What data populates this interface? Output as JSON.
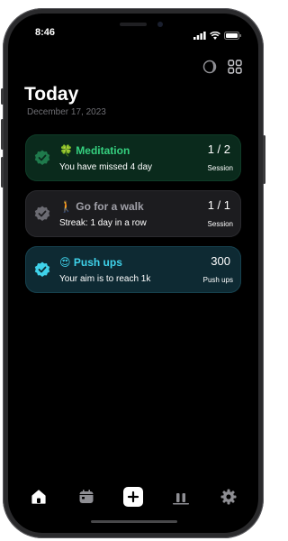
{
  "status_bar": {
    "time": "8:46"
  },
  "header": {
    "title": "Today",
    "date": "December 17, 2023"
  },
  "colors": {
    "meditation": "#35d07f",
    "walk": "#a0a0a8",
    "pushups": "#3fd2ea"
  },
  "habits": [
    {
      "emoji": "🍀",
      "name": "Meditation",
      "subtitle": "You have missed 4 day",
      "count": "1 / 2",
      "unit": "Session",
      "check_icon": "check-badge-icon"
    },
    {
      "emoji": "🚶",
      "name": "Go for a walk",
      "subtitle": "Streak: 1 day in a row",
      "count": "1 / 1",
      "unit": "Session",
      "check_icon": "check-badge-icon"
    },
    {
      "emoji": "😍",
      "name": "Push ups",
      "subtitle": "Your aim is to reach 1k",
      "count": "300",
      "unit": "Push ups",
      "check_icon": "check-badge-icon"
    }
  ],
  "tabs": [
    "home-icon",
    "calendar-icon",
    "add-icon",
    "stats-icon",
    "settings-icon"
  ]
}
